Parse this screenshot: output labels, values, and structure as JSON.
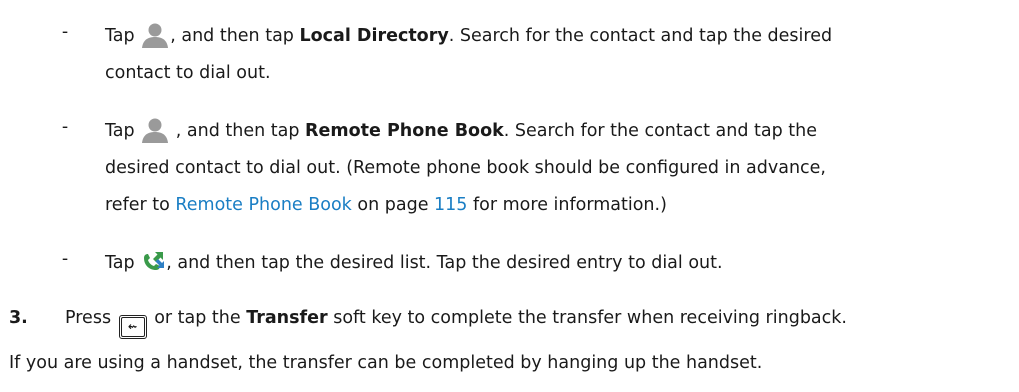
{
  "bullet_1": {
    "dash": "-",
    "pre": "Tap",
    "mid": ", and then tap ",
    "bold": "Local Directory",
    "post": ". Search for the contact and tap the desired",
    "line2": "contact to dial out.",
    "icon": "contact-person-icon"
  },
  "bullet_2": {
    "dash": "-",
    "pre": "Tap",
    "mid": ", and then tap ",
    "bold": "Remote Phone Book",
    "post": ". Search for the contact and tap the",
    "line2": "desired contact to dial out. (Remote phone book should be configured in advance,",
    "line3_pre": "refer to ",
    "line3_link": "Remote Phone Book",
    "line3_mid": " on page ",
    "line3_page": "115",
    "line3_post": " for more information.)",
    "icon": "contact-person-icon"
  },
  "bullet_3": {
    "dash": "-",
    "pre": "Tap",
    "post": ", and then tap the desired list. Tap the desired entry to dial out.",
    "icon": "call-history-icon"
  },
  "step_3": {
    "number": "3.",
    "pre": "Press",
    "key_glyph": "⇜",
    "mid": " or tap the ",
    "bold": "Transfer",
    "post": " soft key to complete the transfer when receiving ringback.",
    "key_icon": "transfer-key-icon"
  },
  "footer_text": "If you are using a handset, the transfer can be completed by hanging up the handset.",
  "colors": {
    "link": "#1a7ec4",
    "icon_gray": "#9a9a9a",
    "icon_green": "#3a9a4a",
    "icon_blue": "#2e7fc4"
  }
}
